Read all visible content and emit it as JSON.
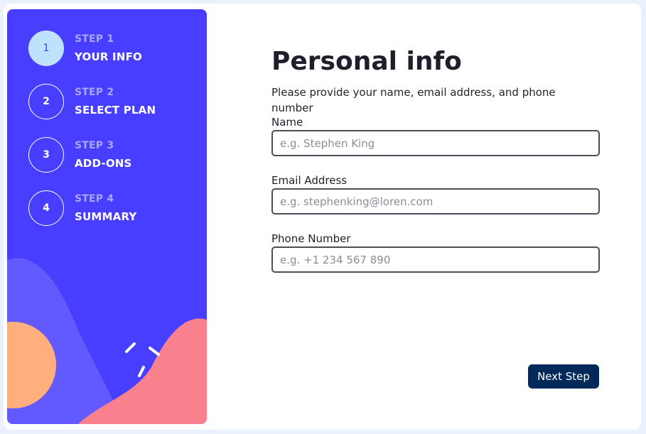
{
  "steps": [
    {
      "number": "1",
      "sub": "STEP 1",
      "title": "YOUR INFO",
      "active": true
    },
    {
      "number": "2",
      "sub": "STEP 2",
      "title": "SELECT PLAN",
      "active": false
    },
    {
      "number": "3",
      "sub": "STEP 3",
      "title": "ADD-ONS",
      "active": false
    },
    {
      "number": "4",
      "sub": "STEP 4",
      "title": "SUMMARY",
      "active": false
    }
  ],
  "form": {
    "title": "Personal info",
    "subtitle": "Please provide your name, email address, and phone number",
    "fields": [
      {
        "label": "Name",
        "placeholder": "e.g. Stephen King",
        "value": ""
      },
      {
        "label": "Email Address",
        "placeholder": "e.g. stephenking@loren.com",
        "value": ""
      },
      {
        "label": "Phone Number",
        "placeholder": "e.g. +1 234 567 890",
        "value": ""
      }
    ],
    "next_label": "Next Step"
  },
  "colors": {
    "sidebar": "#483eff",
    "active_step_bg": "#bee2fd",
    "button": "#02295a",
    "shape_purple": "#6259ff",
    "shape_orange": "#ffaf7e",
    "shape_pink": "#f9818e"
  }
}
